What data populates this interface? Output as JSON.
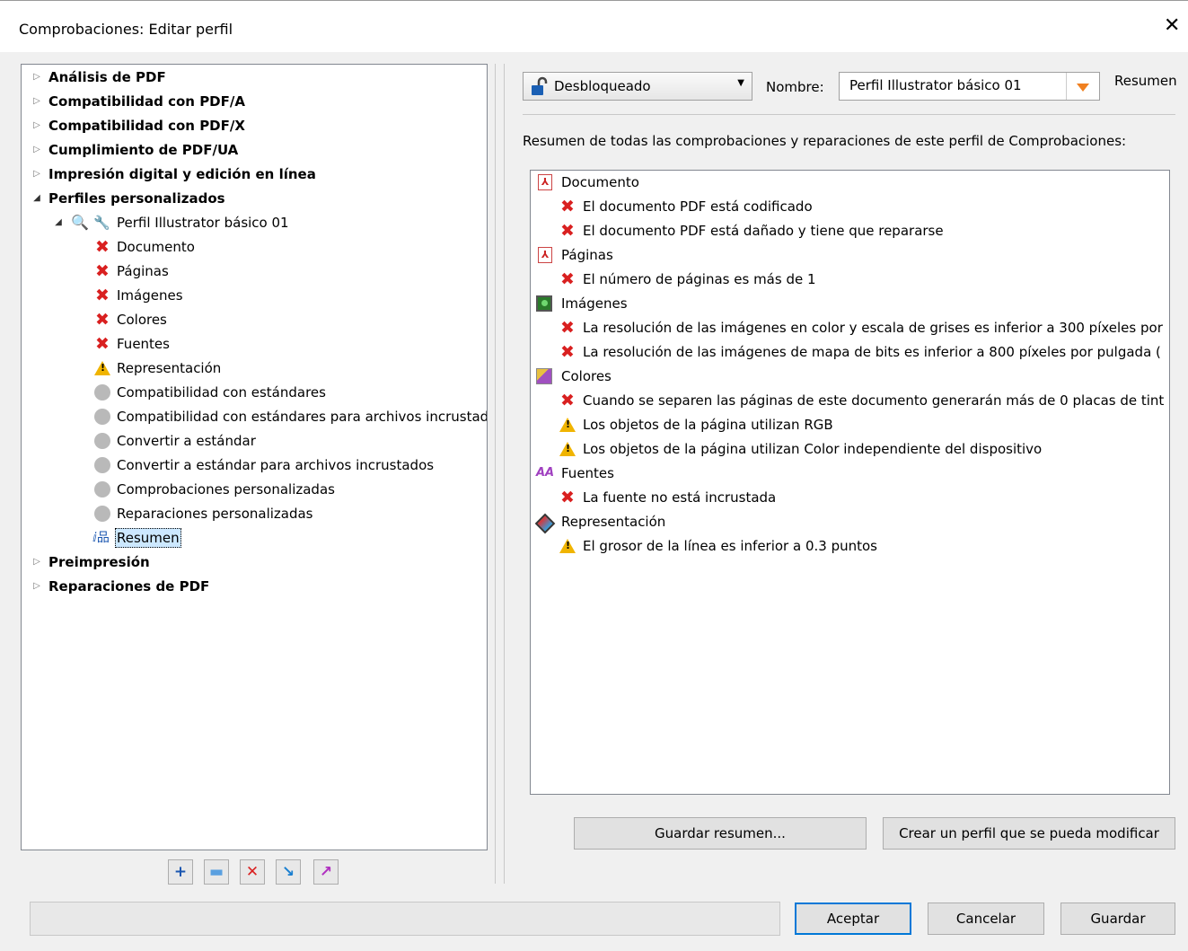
{
  "window": {
    "title": "Comprobaciones: Editar perfil",
    "close_glyph": "✕"
  },
  "tree": {
    "items": [
      {
        "label": "Análisis de PDF"
      },
      {
        "label": "Compatibilidad con PDF/A"
      },
      {
        "label": "Compatibilidad con PDF/X"
      },
      {
        "label": "Cumplimiento de PDF/UA"
      },
      {
        "label": "Impresión digital y edición en línea"
      },
      {
        "label": "Perfiles personalizados"
      },
      {
        "label": "Perfil Illustrator básico 01"
      },
      {
        "label": "Documento",
        "icon": "error-icon"
      },
      {
        "label": "Páginas",
        "icon": "error-icon"
      },
      {
        "label": "Imágenes",
        "icon": "error-icon"
      },
      {
        "label": "Colores",
        "icon": "error-icon"
      },
      {
        "label": "Fuentes",
        "icon": "error-icon"
      },
      {
        "label": "Representación",
        "icon": "warning-icon"
      },
      {
        "label": "Compatibilidad con estándares",
        "icon": "inactive-icon"
      },
      {
        "label": "Compatibilidad con estándares para archivos incrustados",
        "icon": "inactive-icon"
      },
      {
        "label": "Convertir a estándar",
        "icon": "inactive-icon"
      },
      {
        "label": "Convertir a estándar para archivos incrustados",
        "icon": "inactive-icon"
      },
      {
        "label": "Comprobaciones personalizadas",
        "icon": "inactive-icon"
      },
      {
        "label": "Reparaciones personalizadas",
        "icon": "inactive-icon"
      },
      {
        "label": "Resumen",
        "icon": "summary-icon"
      },
      {
        "label": "Preimpresión"
      },
      {
        "label": "Reparaciones de PDF"
      }
    ]
  },
  "toolbar": {
    "add_icon": "+",
    "duplicate_icon": "▬",
    "delete_icon": "✕",
    "import_icon": "↘",
    "export_icon": "↗"
  },
  "header": {
    "lock_state": "Desbloqueado",
    "name_label": "Nombre:",
    "name_value": "Perfil Illustrator básico 01",
    "tab_label": "Resumen"
  },
  "summary": {
    "description": "Resumen de todas las comprobaciones y reparaciones de este perfil de Comprobaciones:",
    "rows": [
      {
        "label": "Documento"
      },
      {
        "label": "El documento PDF está codificado"
      },
      {
        "label": "El documento PDF está dañado y tiene que repararse"
      },
      {
        "label": "Páginas"
      },
      {
        "label": "El número de páginas es más de 1"
      },
      {
        "label": "Imágenes"
      },
      {
        "label": "La resolución de las imágenes en color y escala de grises es inferior a 300 píxeles por"
      },
      {
        "label": "La resolución de las imágenes de mapa de bits es inferior a 800 píxeles por pulgada ("
      },
      {
        "label": "Colores"
      },
      {
        "label": "Cuando se separen las páginas de este documento generarán más de 0 placas de tint"
      },
      {
        "label": "Los objetos de la página utilizan RGB"
      },
      {
        "label": "Los objetos de la página utilizan Color independiente del dispositivo"
      },
      {
        "label": "Fuentes"
      },
      {
        "label": "La fuente no está incrustada"
      },
      {
        "label": "Representación"
      },
      {
        "label": "El grosor de la línea es inferior a 0.3 puntos"
      }
    ]
  },
  "actions": {
    "save_summary": "Guardar resumen...",
    "create_editable": "Crear un perfil que se pueda modificar"
  },
  "footer": {
    "ok": "Aceptar",
    "cancel": "Cancelar",
    "save": "Guardar"
  }
}
